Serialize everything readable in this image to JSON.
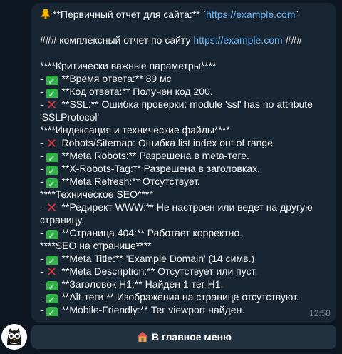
{
  "message": {
    "header_title": "**Первичный отчет для сайта:** `",
    "header_link": "https://example.com",
    "header_tail": "`",
    "subtitle_prefix": "###  комплексный отчет по сайту ",
    "subtitle_link": "https://example.com",
    "subtitle_suffix": " ###",
    "sections": {
      "critical": "****Критически важные параметры****",
      "indexing": "****Индексация и технические файлы****",
      "tech_seo": "****Техническое SEO****",
      "onpage": "****SEO на странице****"
    },
    "items": {
      "response_time": " **Время ответа:** 89 мс",
      "response_code": " **Код ответа:** Получен код 200.",
      "ssl_1": " **SSL:** Ошибка проверки: module 'ssl' has no attribute",
      "ssl_2": "'SSLProtocol'",
      "robots_sitemap": " Robots/Sitemap: Ошибка list index out of range",
      "meta_robots": " **Meta Robots:** Разрешена в meta-теге.",
      "x_robots": " **X-Robots-Tag:** Разрешена в заголовках.",
      "meta_refresh": " **Meta Refresh:** Отсутствует.",
      "www_redirect_1": " **Редирект WWW:** Не настроен или ведет на другую",
      "www_redirect_2": "страницу.",
      "page_404": " **Страница 404:** Работает корректно.",
      "meta_title": " **Meta Title:** 'Example Domain' (14 симв.)",
      "meta_description": " **Meta Description:** Отсутствует или пуст.",
      "h1": " **Заголовок H1:** Найден 1 тег H1.",
      "alt_tags": " **Alt-теги:** Изображения на странице отсутствуют.",
      "mobile_friendly": " **Mobile-Friendly:** Тег viewport найден."
    },
    "bullet": "- ",
    "time": "12:58"
  },
  "button": {
    "label": "В главное меню"
  },
  "icons": {
    "bell": "bell-icon",
    "check": "check-mark-icon",
    "cross": "cross-mark-icon",
    "house": "house-icon",
    "avatar": "owl-avatar"
  },
  "colors": {
    "background": "#0e1621",
    "bubble": "#182533",
    "link": "#6ab3f3",
    "check": "#2fb344",
    "cross": "#e0353c",
    "button": "#22313f"
  }
}
